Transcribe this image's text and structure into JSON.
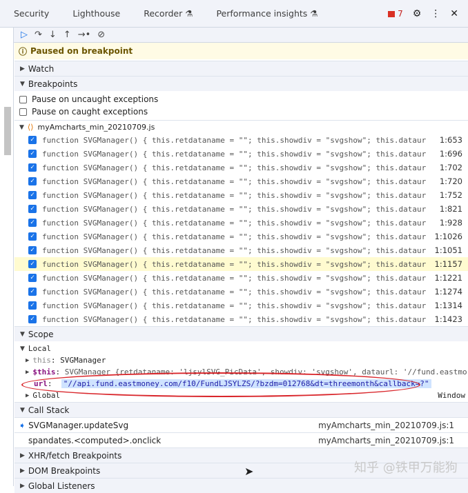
{
  "tabs": [
    "Security",
    "Lighthouse",
    "Recorder",
    "Performance insights"
  ],
  "issues_count": "7",
  "paused": "Paused on breakpoint",
  "sections": {
    "watch": "Watch",
    "breakpoints": "Breakpoints",
    "scope": "Scope",
    "call_stack": "Call Stack",
    "xhr": "XHR/fetch Breakpoints",
    "dom": "DOM Breakpoints",
    "global_listeners": "Global Listeners"
  },
  "exceptions": [
    "Pause on uncaught exceptions",
    "Pause on caught exceptions"
  ],
  "file": "myAmcharts_min_20210709.js",
  "bp_code": "function SVGManager() { this.retdataname = \"\"; this.showdiv = \"svgshow\"; this.dataurl",
  "bp_lines": [
    "1:653",
    "1:696",
    "1:702",
    "1:720",
    "1:752",
    "1:821",
    "1:928",
    "1:1026",
    "1:1051",
    "1:1157",
    "1:1221",
    "1:1274",
    "1:1314",
    "1:1423"
  ],
  "scope": {
    "local": "Local",
    "this_key": "this",
    "this_val": "SVGManager",
    "sthis_key": "$this",
    "sthis_val": "SVGManager {retdataname: 'ljsylSVG_PicData', showdiv: 'svgshow', dataurl: '//fund.eastmo",
    "url_key": "url",
    "url_val": "\"//api.fund.eastmoney.com/f10/FundLJSYLZS/?bzdm=012768&dt=threemonth&callback=?\"",
    "global": "Global",
    "global_val": "Window"
  },
  "callstack": [
    {
      "fn": "SVGManager.updateSvg",
      "loc": "myAmcharts_min_20210709.js:1"
    },
    {
      "fn": "spandates.<computed>.onclick",
      "loc": "myAmcharts_min_20210709.js:1"
    }
  ],
  "watermark": "知乎 @铁甲万能狗"
}
